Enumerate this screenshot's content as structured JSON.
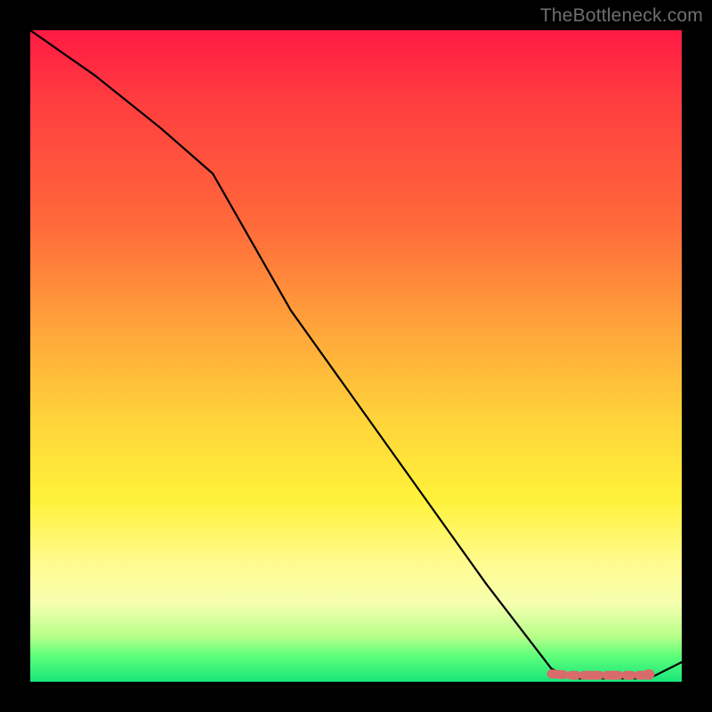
{
  "watermark": "TheBottleneck.com",
  "chart_data": {
    "type": "line",
    "title": "",
    "xlabel": "",
    "ylabel": "",
    "xlim": [
      0,
      100
    ],
    "ylim": [
      0,
      100
    ],
    "series": [
      {
        "name": "curve",
        "x": [
          0,
          10,
          20,
          28,
          40,
          55,
          70,
          80,
          83,
          88,
          92,
          95,
          100
        ],
        "values": [
          100,
          93,
          85,
          78,
          57,
          36,
          15,
          2,
          0.5,
          0.5,
          0.5,
          0.5,
          3
        ]
      },
      {
        "name": "marker-band",
        "x": [
          80,
          83,
          86,
          88,
          90,
          92,
          94,
          95
        ],
        "values": [
          1.2,
          1.0,
          1.0,
          1.0,
          1.0,
          1.0,
          1.0,
          1.1
        ]
      }
    ],
    "marker_color": "#d96b6b",
    "line_color": "#000000"
  }
}
